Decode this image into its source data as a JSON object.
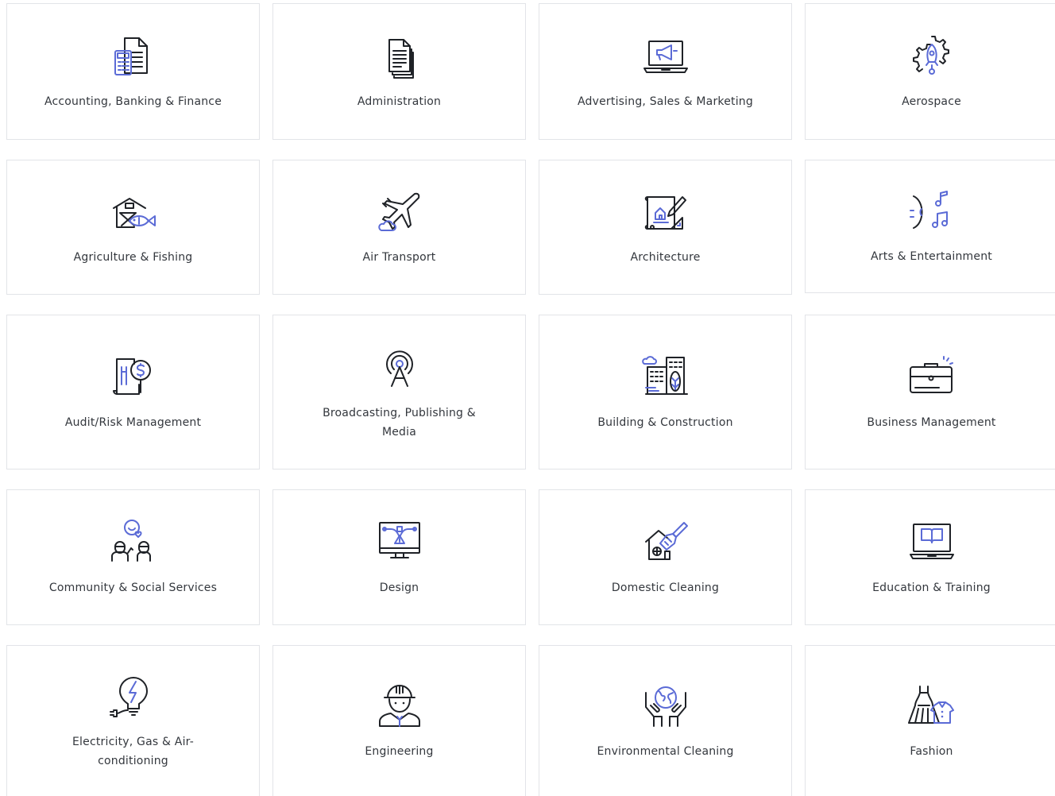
{
  "accent_color": "#5b6bd6",
  "ink_color": "#1f2227",
  "categories": [
    {
      "label": "Accounting, Banking & Finance",
      "icon": "calculator-document-icon"
    },
    {
      "label": "Administration",
      "icon": "stacked-documents-icon"
    },
    {
      "label": "Advertising, Sales & Marketing",
      "icon": "laptop-megaphone-icon"
    },
    {
      "label": "Aerospace",
      "icon": "gear-rocket-icon"
    },
    {
      "label": "Agriculture & Fishing",
      "icon": "barn-fish-icon"
    },
    {
      "label": "Air Transport",
      "icon": "airplane-cloud-icon"
    },
    {
      "label": "Architecture",
      "icon": "blueprint-pencil-icon"
    },
    {
      "label": "Arts & Entertainment",
      "icon": "music-notes-icon"
    },
    {
      "label": "Audit/Risk Management",
      "icon": "document-magnifier-dollar-icon"
    },
    {
      "label": "Broadcasting, Publishing & Media",
      "icon": "broadcast-tower-icon"
    },
    {
      "label": "Building & Construction",
      "icon": "buildings-tree-icon"
    },
    {
      "label": "Business Management",
      "icon": "briefcase-icon"
    },
    {
      "label": "Community & Social Services",
      "icon": "people-heart-icon"
    },
    {
      "label": "Design",
      "icon": "monitor-pen-tool-icon"
    },
    {
      "label": "Domestic Cleaning",
      "icon": "house-brush-icon"
    },
    {
      "label": "Education & Training",
      "icon": "laptop-book-icon"
    },
    {
      "label": "Electricity, Gas & Air-conditioning",
      "icon": "lightbulb-bolt-icon"
    },
    {
      "label": "Engineering",
      "icon": "engineer-helmet-icon"
    },
    {
      "label": "Environmental Cleaning",
      "icon": "hands-globe-icon"
    },
    {
      "label": "Fashion",
      "icon": "dress-shirt-icon"
    }
  ]
}
